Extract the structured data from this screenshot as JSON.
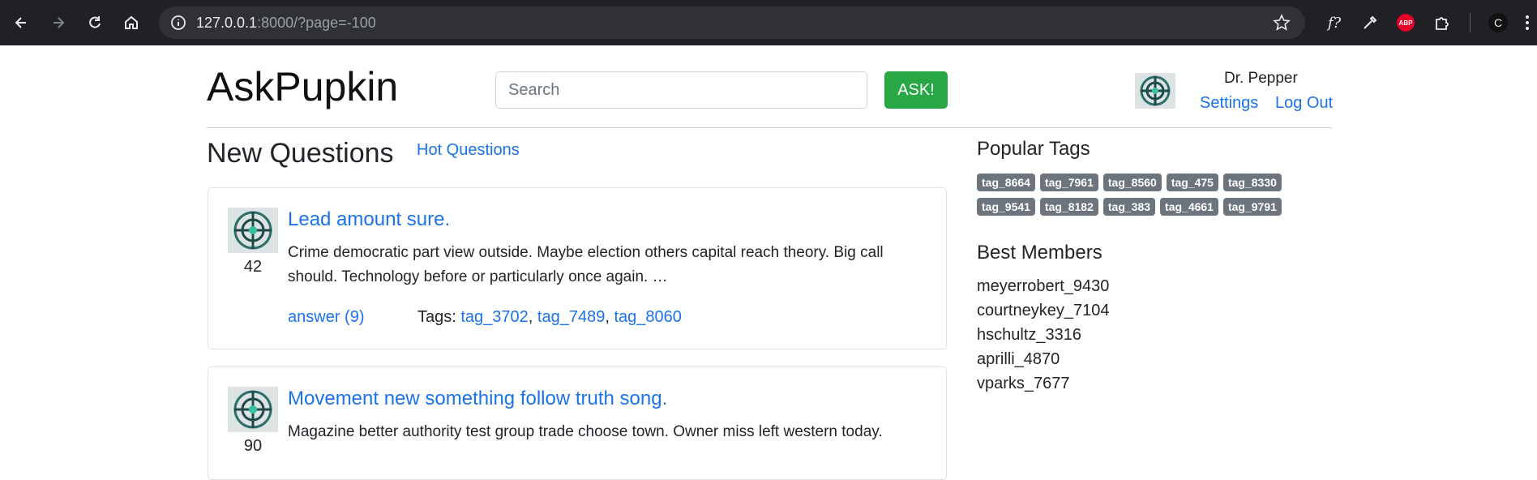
{
  "browser": {
    "url_host": "127.0.0.1",
    "url_path": ":8000/?page=-100",
    "profile_initial": "C",
    "abp_label": "ABP",
    "fx_label": "f?"
  },
  "header": {
    "brand": "AskPupkin",
    "search_placeholder": "Search",
    "ask_label": "ASK!",
    "user_name": "Dr. Pepper",
    "settings_label": "Settings",
    "logout_label": "Log Out"
  },
  "main": {
    "title": "New Questions",
    "hot_link": "Hot Questions",
    "questions": [
      {
        "rating": "42",
        "title": "Lead amount sure.",
        "text": "Crime democratic part view outside. Maybe election others capital reach theory. Big call should. Technology before or particularly once again. …",
        "answer_label": "answer (9)",
        "tags_label": "Tags:",
        "tags": [
          "tag_3702",
          "tag_7489",
          "tag_8060"
        ]
      },
      {
        "rating": "90",
        "title": "Movement new something follow truth song.",
        "text": "Magazine better authority test group trade choose town. Owner miss left western today."
      }
    ]
  },
  "sidebar": {
    "popular_title": "Popular Tags",
    "tags": [
      "tag_8664",
      "tag_7961",
      "tag_8560",
      "tag_475",
      "tag_8330",
      "tag_9541",
      "tag_8182",
      "tag_383",
      "tag_4661",
      "tag_9791"
    ],
    "members_title": "Best Members",
    "members": [
      "meyerrobert_9430",
      "courtneykey_7104",
      "hschultz_3316",
      "aprilli_4870",
      "vparks_7677"
    ]
  },
  "colors": {
    "link": "#1a73e8",
    "ask_button": "#28a745",
    "tag_badge": "#6c757d",
    "chrome_bg": "#202124"
  },
  "icons": [
    "back-icon",
    "forward-icon",
    "reload-icon",
    "home-icon",
    "info-icon",
    "star-icon",
    "eyedropper-icon",
    "puzzle-icon"
  ]
}
